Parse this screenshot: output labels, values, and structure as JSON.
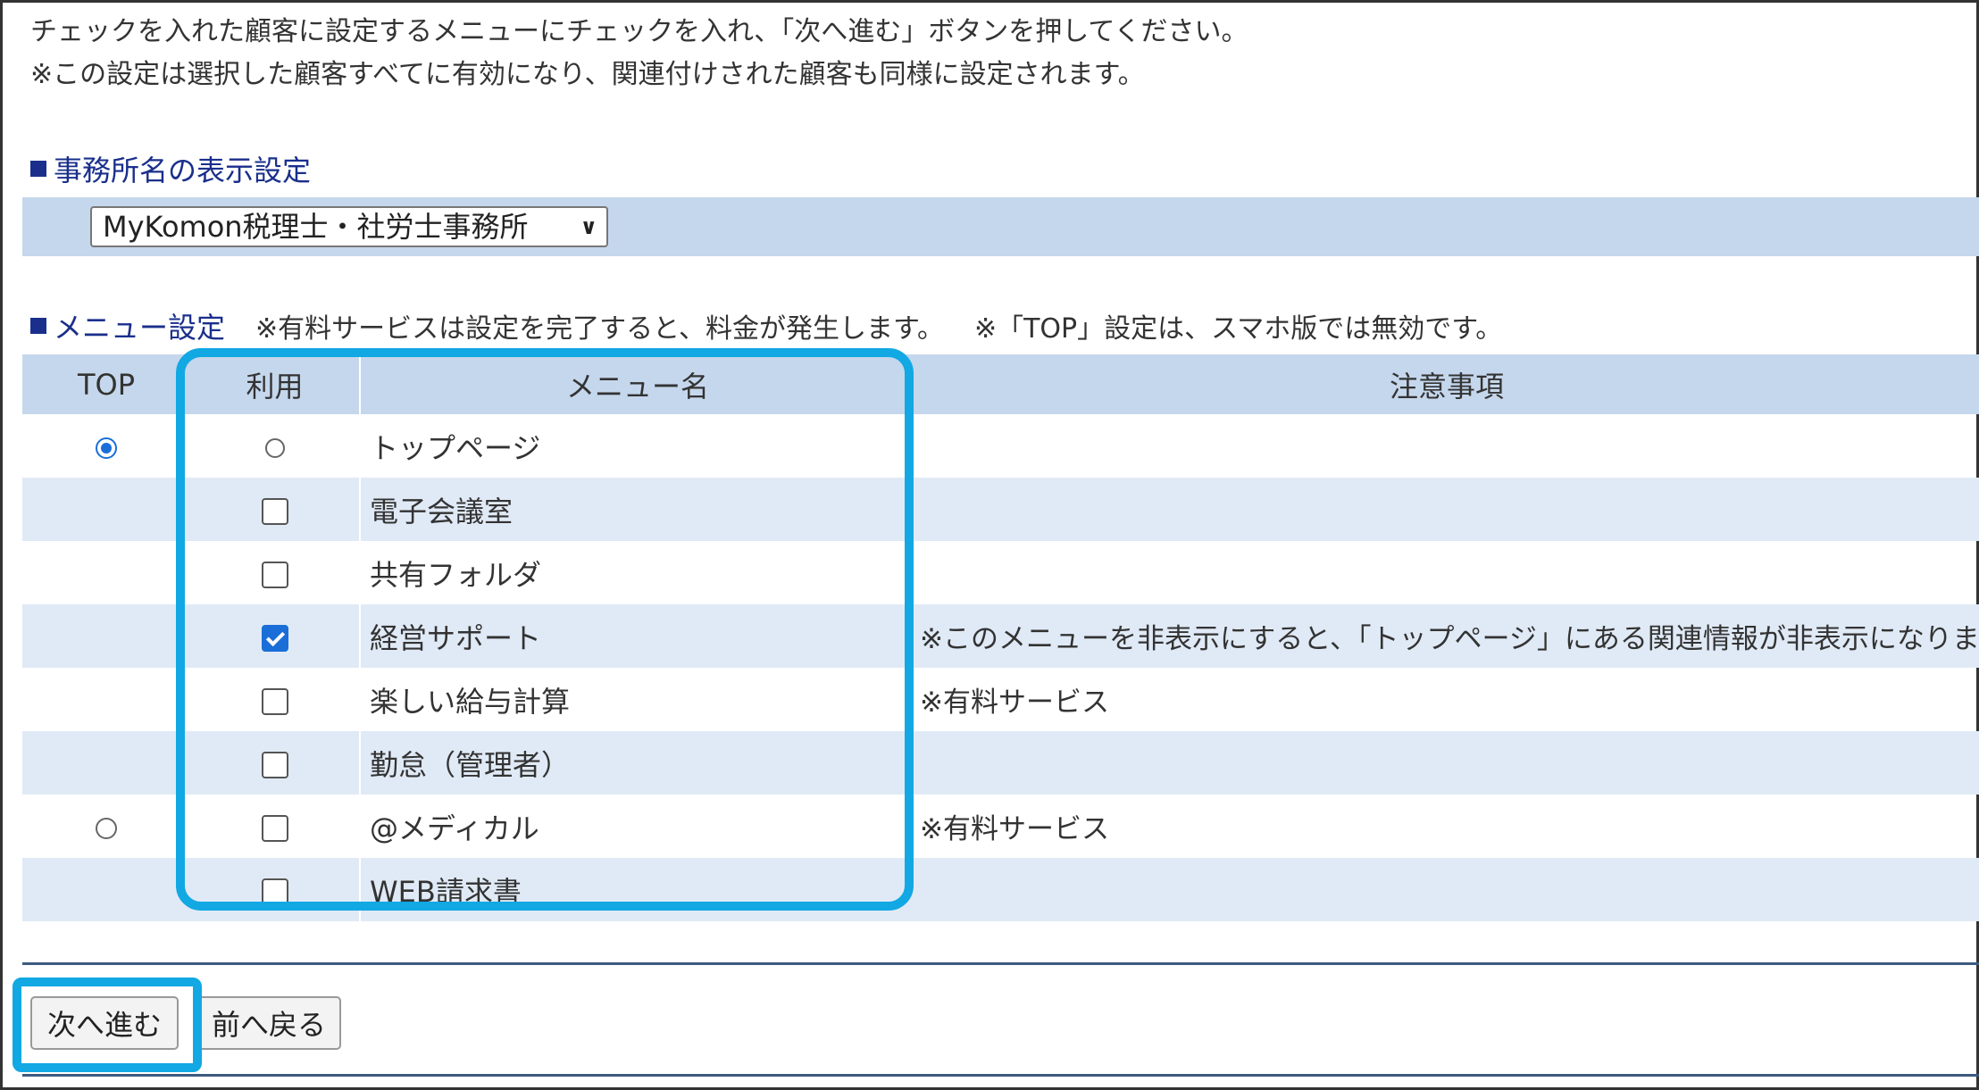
{
  "intro": {
    "line1": "チェックを入れた顧客に設定するメニューにチェックを入れ、「次へ進む」ボタンを押してください。",
    "line2": "※この設定は選択した顧客すべてに有効になり、関連付けされた顧客も同様に設定されます。"
  },
  "office_section": {
    "title": "事務所名の表示設定",
    "selected_office": "MyKomon税理士・社労士事務所"
  },
  "menu_section": {
    "title": "メニュー設定",
    "note_paid": "※有料サービスは設定を完了すると、料金が発生します。",
    "note_top": "※「TOP」設定は、スマホ版では無効です。",
    "headers": {
      "top": "TOP",
      "use": "利用",
      "name": "メニュー名",
      "notes": "注意事項"
    },
    "rows": [
      {
        "top": "selected",
        "use": "radio",
        "name": "トップページ",
        "note": "",
        "paid": false
      },
      {
        "top": "none",
        "use": "unchecked",
        "name": "電子会議室",
        "note": "",
        "paid": false
      },
      {
        "top": "none",
        "use": "unchecked",
        "name": "共有フォルダ",
        "note": "",
        "paid": false
      },
      {
        "top": "none",
        "use": "checked",
        "name": "経営サポート",
        "note": "※このメニューを非表示にすると、「トップページ」にある関連情報が非表示になります。",
        "paid": false
      },
      {
        "top": "none",
        "use": "unchecked",
        "name": "楽しい給与計算",
        "note": "※有料サービス",
        "paid": true
      },
      {
        "top": "none",
        "use": "unchecked",
        "name": "勤怠（管理者）",
        "note": "",
        "paid": false
      },
      {
        "top": "unselected",
        "use": "unchecked",
        "name": "@メディカル",
        "note": "※有料サービス",
        "paid": true
      },
      {
        "top": "none",
        "use": "unchecked",
        "name": "WEB請求書",
        "note": "",
        "paid": false
      }
    ]
  },
  "buttons": {
    "next": "次へ進む",
    "back": "前へ戻る"
  },
  "colors": {
    "highlight": "#12a8e3",
    "header_bg": "#c5d7ec",
    "paid_text": "#e00000",
    "section_title": "#1a2f8c"
  }
}
